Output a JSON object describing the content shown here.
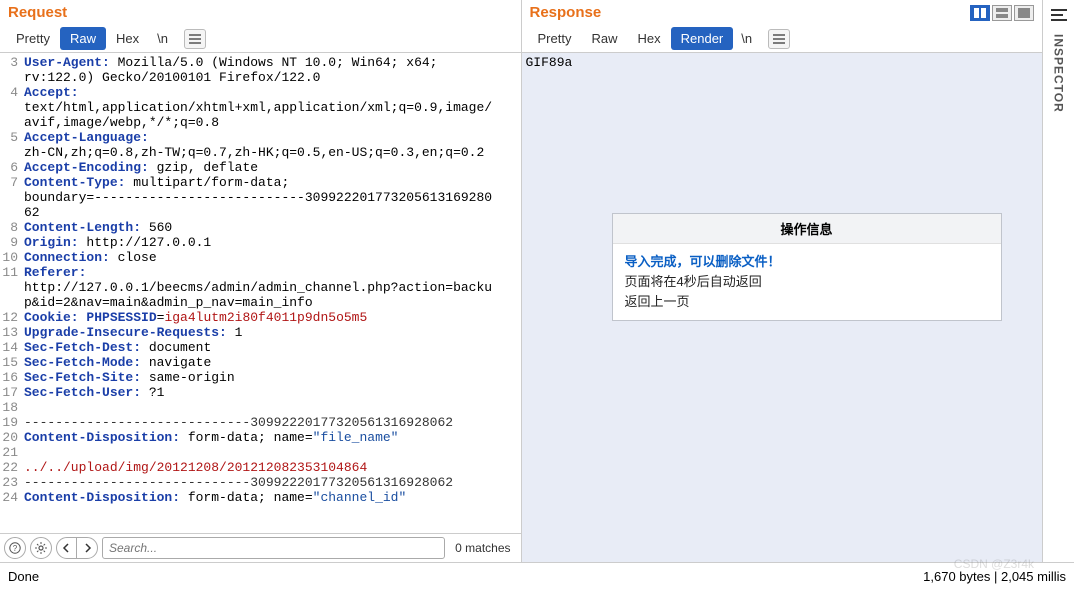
{
  "request": {
    "title": "Request",
    "tabs": {
      "pretty": "Pretty",
      "raw": "Raw",
      "hex": "Hex",
      "nl": "\\n"
    },
    "lines": [
      {
        "n": 3,
        "t": "hdr",
        "k": "User-Agent:",
        "v": " Mozilla/5.0 (Windows NT 10.0; Win64; x64;"
      },
      {
        "n": "",
        "t": "cont",
        "v": "rv:122.0) Gecko/20100101 Firefox/122.0"
      },
      {
        "n": 4,
        "t": "hdr",
        "k": "Accept:",
        "v": ""
      },
      {
        "n": "",
        "t": "cont",
        "v": "text/html,application/xhtml+xml,application/xml;q=0.9,image/"
      },
      {
        "n": "",
        "t": "cont",
        "v": "avif,image/webp,*/*;q=0.8"
      },
      {
        "n": 5,
        "t": "hdr",
        "k": "Accept-Language:",
        "v": ""
      },
      {
        "n": "",
        "t": "cont",
        "v": "zh-CN,zh;q=0.8,zh-TW;q=0.7,zh-HK;q=0.5,en-US;q=0.3,en;q=0.2"
      },
      {
        "n": 6,
        "t": "hdr",
        "k": "Accept-Encoding:",
        "v": " gzip, deflate"
      },
      {
        "n": 7,
        "t": "hdr",
        "k": "Content-Type:",
        "v": " multipart/form-data;"
      },
      {
        "n": "",
        "t": "cont",
        "v": "boundary=---------------------------309922201773205613169280"
      },
      {
        "n": "",
        "t": "cont",
        "v": "62"
      },
      {
        "n": 8,
        "t": "hdr",
        "k": "Content-Length:",
        "v": " 560"
      },
      {
        "n": 9,
        "t": "hdr",
        "k": "Origin:",
        "v": " http://127.0.0.1"
      },
      {
        "n": 10,
        "t": "hdr",
        "k": "Connection:",
        "v": " close"
      },
      {
        "n": 11,
        "t": "hdr",
        "k": "Referer:",
        "v": ""
      },
      {
        "n": "",
        "t": "cont",
        "v": "http://127.0.0.1/beecms/admin/admin_channel.php?action=backu"
      },
      {
        "n": "",
        "t": "cont",
        "v": "p&id=2&nav=main&admin_p_nav=main_info"
      },
      {
        "n": 12,
        "t": "cookie",
        "k": "Cookie:",
        "ck": " PHPSESSID",
        "cv": "iga4lutm2i80f4011p9dn5o5m5"
      },
      {
        "n": 13,
        "t": "hdr",
        "k": "Upgrade-Insecure-Requests:",
        "v": " 1"
      },
      {
        "n": 14,
        "t": "hdr",
        "k": "Sec-Fetch-Dest:",
        "v": " document"
      },
      {
        "n": 15,
        "t": "hdr",
        "k": "Sec-Fetch-Mode:",
        "v": " navigate"
      },
      {
        "n": 16,
        "t": "hdr",
        "k": "Sec-Fetch-Site:",
        "v": " same-origin"
      },
      {
        "n": 17,
        "t": "hdr",
        "k": "Sec-Fetch-User:",
        "v": " ?1"
      },
      {
        "n": 18,
        "t": "blank",
        "v": ""
      },
      {
        "n": 19,
        "t": "dash",
        "v": "-----------------------------30992220177320561316928062"
      },
      {
        "n": 20,
        "t": "cd",
        "k": "Content-Disposition:",
        "v": " form-data; name=",
        "q": "\"file_name\""
      },
      {
        "n": 21,
        "t": "blank",
        "v": ""
      },
      {
        "n": 22,
        "t": "red",
        "v": "../../upload/img/20121208/201212082353104864"
      },
      {
        "n": 23,
        "t": "dash",
        "v": "-----------------------------30992220177320561316928062"
      },
      {
        "n": 24,
        "t": "cd",
        "k": "Content-Disposition:",
        "v": " form-data; name=",
        "q": "\"channel_id\""
      }
    ]
  },
  "response": {
    "title": "Response",
    "tabs": {
      "pretty": "Pretty",
      "raw": "Raw",
      "hex": "Hex",
      "render": "Render",
      "nl": "\\n"
    },
    "top_text": "GIF89a",
    "dialog": {
      "title": "操作信息",
      "line1": "导入完成，可以删除文件！",
      "line2": "页面将在4秒后自动返回",
      "line3": "返回上一页"
    }
  },
  "search": {
    "placeholder": "Search...",
    "matches": "0 matches"
  },
  "status": {
    "left": "Done",
    "right": "1,670 bytes | 2,045 millis"
  },
  "rail": {
    "label": "INSPECTOR"
  }
}
